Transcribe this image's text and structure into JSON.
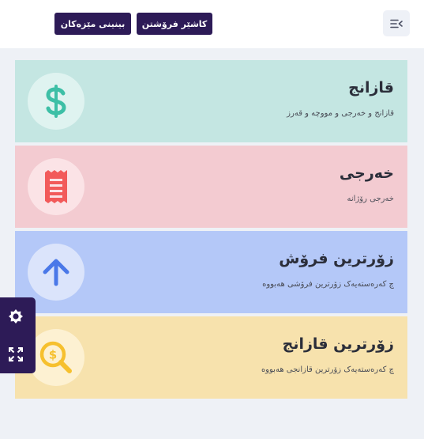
{
  "header": {
    "cashier_button_label": "کاشێر فرۆشتن",
    "cashier_b_button_label": "بینینی مێزەکان",
    "menu_icon": "menu-collapse-icon"
  },
  "cards": [
    {
      "title": "قازانج",
      "subtitle": "قازانج و خەرجی و مووچە و قەرز",
      "icon": "dollar-icon",
      "background": "#c4e6e2",
      "accent": "#3dbfa6"
    },
    {
      "title": "خەرجی",
      "subtitle": "خەرجی رۆژانە",
      "icon": "receipt-icon",
      "background": "#f3cbd1",
      "accent": "#f25a5a"
    },
    {
      "title": "زۆرترین فرۆش",
      "subtitle": "چ کەرەستەیەک زۆرترین فرۆشی هەبووە",
      "icon": "arrow-up-icon",
      "background": "#b4c8f8",
      "accent": "#4a78e8"
    },
    {
      "title": "زۆرترین قازانج",
      "subtitle": "چ کەرەستەیەک زۆرترین قازانجی هەبووە",
      "icon": "search-dollar-icon",
      "background": "#f7e2ad",
      "accent": "#f6c02e"
    }
  ],
  "side_panel": {
    "theme_icon": "brightness-icon",
    "fullscreen_icon": "fullscreen-icon",
    "background": "#2d1b57"
  }
}
